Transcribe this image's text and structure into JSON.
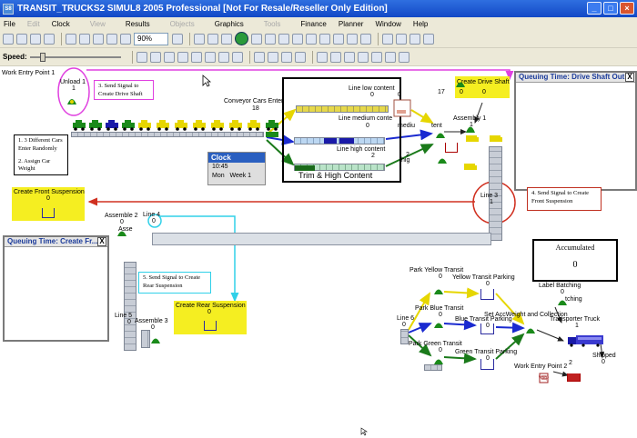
{
  "window": {
    "app_icon": "S8",
    "title": "TRANSIT_TRUCKS2   SIMUL8 2005 Professional [Not For Resale/Reseller Only Edition]",
    "minimize": "_",
    "maximize": "□",
    "close": "×"
  },
  "menu": [
    "File",
    "Edit",
    "Clock",
    "View",
    "Results",
    "Objects",
    "Graphics",
    "Tools",
    "Finance",
    "Planner",
    "Window",
    "Help"
  ],
  "menu_disabled": [
    "Edit",
    "View",
    "Objects",
    "Tools"
  ],
  "toolbar": {
    "zoom": "90%",
    "speed_label": "Speed:",
    "speed_fraction": 0.12
  },
  "clock": {
    "title": "Clock",
    "time": "10:45",
    "day": "Mon",
    "week": "Week 1"
  },
  "panels": {
    "drive_shaft": {
      "title": "Queuing Time: Drive Shaft Out",
      "close": "X"
    },
    "front": {
      "title": "Queuing Time: Create Fr...",
      "close": "X"
    }
  },
  "notes": {
    "n1_line1": "1.  3 Different Cars",
    "n1_line2": "Enter Randomly",
    "n2_line1": "2.  Assign Car",
    "n2_line2": "Weight",
    "n3_line1": "3.  Send Signal to",
    "n3_line2": "Create Drive Shaft",
    "n4_line1": "4.  Send Signal to Create",
    "n4_line2": "Front Suspension",
    "n5_line1": "5.  Send Signal to Create",
    "n5_line2": "Rear Suspension"
  },
  "labels": {
    "work_entry_1": "Work Entry Point 1",
    "unload": "Unload 1",
    "unload_val": "1",
    "conveyor_enter": "Conveyor Cars Enter",
    "conveyor_enter_val": "18",
    "line_low": "Line low content",
    "line_low_val": "0",
    "low_right_val": "0",
    "line_medium": "Line medium conte",
    "line_medium_val": "0",
    "medium_right": "mediu",
    "line_high": "Line high content",
    "line_high_val": "2",
    "high_right": "hig",
    "high_right_val": "2",
    "trim_title": "Trim & High Content",
    "tent": "tent",
    "create_drive_shaft": "Create Drive Shaft",
    "cds_a": "17",
    "cds_b": "0",
    "cds_c": "0",
    "assembly1": "Assembly 1",
    "assembly1_val": "1",
    "create_front": "Create Front Suspension",
    "create_front_val": "0",
    "assemble2": "Assemble 2",
    "assemble2_val": "0",
    "line4": "Line 4",
    "line4_val": "0",
    "line3": "Line 3",
    "line3_val": "1",
    "create_rear": "Create Rear Suspension",
    "create_rear_val": "0",
    "line5": "Line 5",
    "line5_val": "0",
    "assemble3": "Assemble 3",
    "assemble3_val": "0",
    "accumulated": "Accumulated",
    "accumulated_val": "0",
    "park_yellow": "Park Yellow Transit",
    "park_yellow_val": "0",
    "yellow_parking": "Yellow Transit Parking",
    "yellow_parking_val": "0",
    "label_batching": "Label Batching",
    "label_batching_val": "0",
    "batching_suffix": "tching",
    "park_blue": "Park Blue Transit",
    "park_blue_val": "0",
    "set_weight": "Set AccWeight and Collection",
    "blue_parking": "Blue Transit Parking",
    "blue_parking_val": "0",
    "line6": "Line 6",
    "line6_val": "0",
    "transporter_truck": "Transporter Truck",
    "transporter_truck_val": "1",
    "park_green": "Park Green Transit",
    "park_green_val": "0",
    "green_parking": "Green Transit Parking",
    "green_parking_val": "0",
    "shipped": "Shipped",
    "shipped_val": "0",
    "work_entry_2": "Work Entry Point 2",
    "work_entry_2_val": "2",
    "wep_tag": "wep",
    "asse": "Asse"
  },
  "colors": {
    "titlebar": "#1f5ad6",
    "note_pink": "#e040e0",
    "note_cyan": "#30d0e8",
    "note_red": "#c03020",
    "signal_yellow": "#f5ee21",
    "car_green": "#1a8a1a",
    "car_blue": "#1a1aa8",
    "car_yellow": "#e6d600"
  }
}
